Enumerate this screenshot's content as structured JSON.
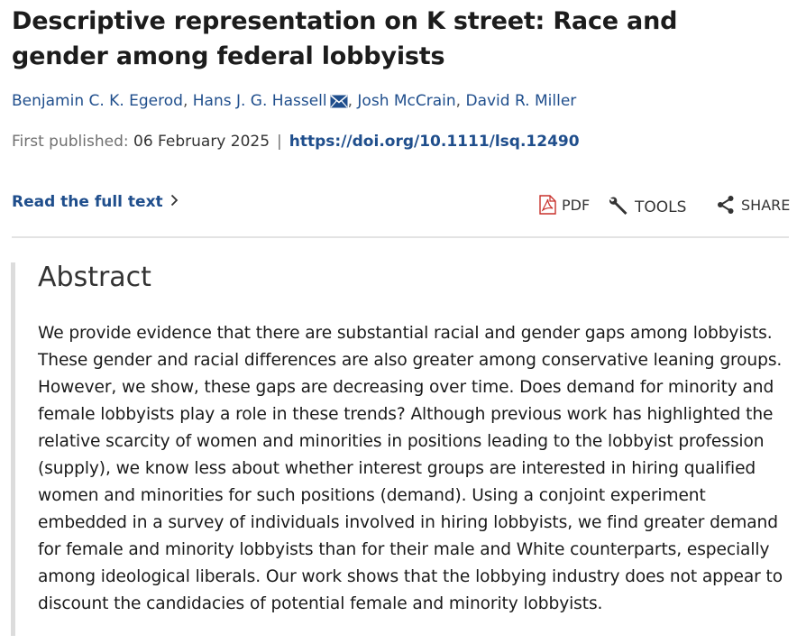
{
  "article": {
    "title": "Descriptive representation on K street: Race and gender among federal lobbyists",
    "authors": [
      {
        "name": "Benjamin C. K. Egerod",
        "corresponding": false
      },
      {
        "name": "Hans J. G. Hassell",
        "corresponding": true
      },
      {
        "name": "Josh McCrain",
        "corresponding": false
      },
      {
        "name": "David R. Miller",
        "corresponding": false
      }
    ],
    "author_separator": ",",
    "first_published_label": "First published:",
    "first_published_date": "06 February 2025",
    "pub_separator": "|",
    "doi": "https://doi.org/10.1111/lsq.12490"
  },
  "toolbar": {
    "read_full_text": "Read the full text",
    "pdf_label": "PDF",
    "tools_label": "TOOLS",
    "share_label": "SHARE"
  },
  "icons": {
    "mail": "envelope-icon",
    "read_chevron": "chevron-right-icon",
    "pdf": "pdf-file-icon",
    "tools": "wrench-icon",
    "share": "share-icon"
  },
  "abstract": {
    "heading": "Abstract",
    "text": "We provide evidence that there are substantial racial and gender gaps among lobbyists. These gender and racial differences are also greater among conservative leaning groups. However, we show, these gaps are decreasing over time. Does demand for minority and female lobbyists play a role in these trends? Although previous work has highlighted the relative scarcity of women and minorities in positions leading to the lobbyist profession (supply), we know less about whether interest groups are interested in hiring qualified women and minorities for such positions (demand). Using a conjoint experiment embedded in a survey of individuals involved in hiring lobbyists, we find greater demand for female and minority lobbyists than for their male and White counterparts, especially among ideological liberals. Our work shows that the lobbying industry does not appear to discount the candidacies of potential female and minority lobbyists."
  },
  "colors": {
    "link": "#1f4e8c",
    "muted": "#707070",
    "pdf_red": "#c8302b",
    "divider": "#e3e3e3"
  }
}
